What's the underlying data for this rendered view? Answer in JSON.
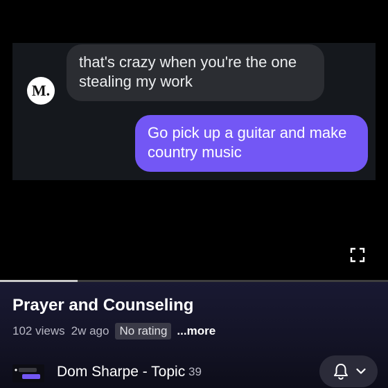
{
  "video": {
    "messages": [
      {
        "sender": "them",
        "avatar_letter": "M.",
        "text": "that's crazy when you're the one stealing my work"
      },
      {
        "sender": "me",
        "text": "Go pick up a guitar and make country music"
      }
    ],
    "progress_fraction": 0.2
  },
  "info": {
    "title": "Prayer and Counseling",
    "views": "102 views",
    "age": "2w ago",
    "rating": "No rating",
    "more": "...more"
  },
  "channel": {
    "name": "Dom Sharpe - Topic",
    "subscribers": "39"
  },
  "icons": {
    "fullscreen": "fullscreen-icon",
    "bell": "bell-icon",
    "chevron": "chevron-down-icon"
  },
  "colors": {
    "outgoing_bubble": "#7357f5",
    "incoming_bubble": "#2b2d32",
    "panel_bg": "#191932"
  }
}
